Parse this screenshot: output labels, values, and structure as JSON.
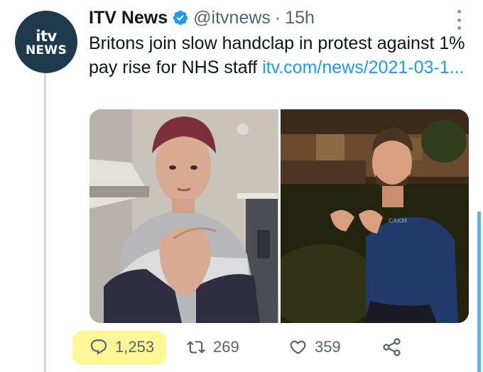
{
  "author": {
    "name": "ITV News",
    "handle": "@itvnews",
    "separator": "·",
    "time": "15h",
    "avatar_logo_top": "itv",
    "avatar_logo_bottom": "NEWS"
  },
  "tweet": {
    "text": "Britons join slow handclap in protest against 1% pay rise for NHS staff",
    "link": "itv.com/news/2021-03-1..."
  },
  "media": {
    "right_photo_shirt_text": "CAKM"
  },
  "actions": {
    "replies": "1,253",
    "retweets": "269",
    "likes": "359"
  },
  "icons": {
    "verified": "verified-badge-icon",
    "more": "more-options-icon",
    "reply": "reply-icon",
    "retweet": "retweet-icon",
    "like": "heart-icon",
    "share": "share-icon"
  },
  "colors": {
    "link": "#1d9bf0",
    "verified": "#1d9bf0",
    "avatar_bg": "#1f3a4d",
    "secondary_text": "#536471",
    "highlight": "#fff36b"
  }
}
